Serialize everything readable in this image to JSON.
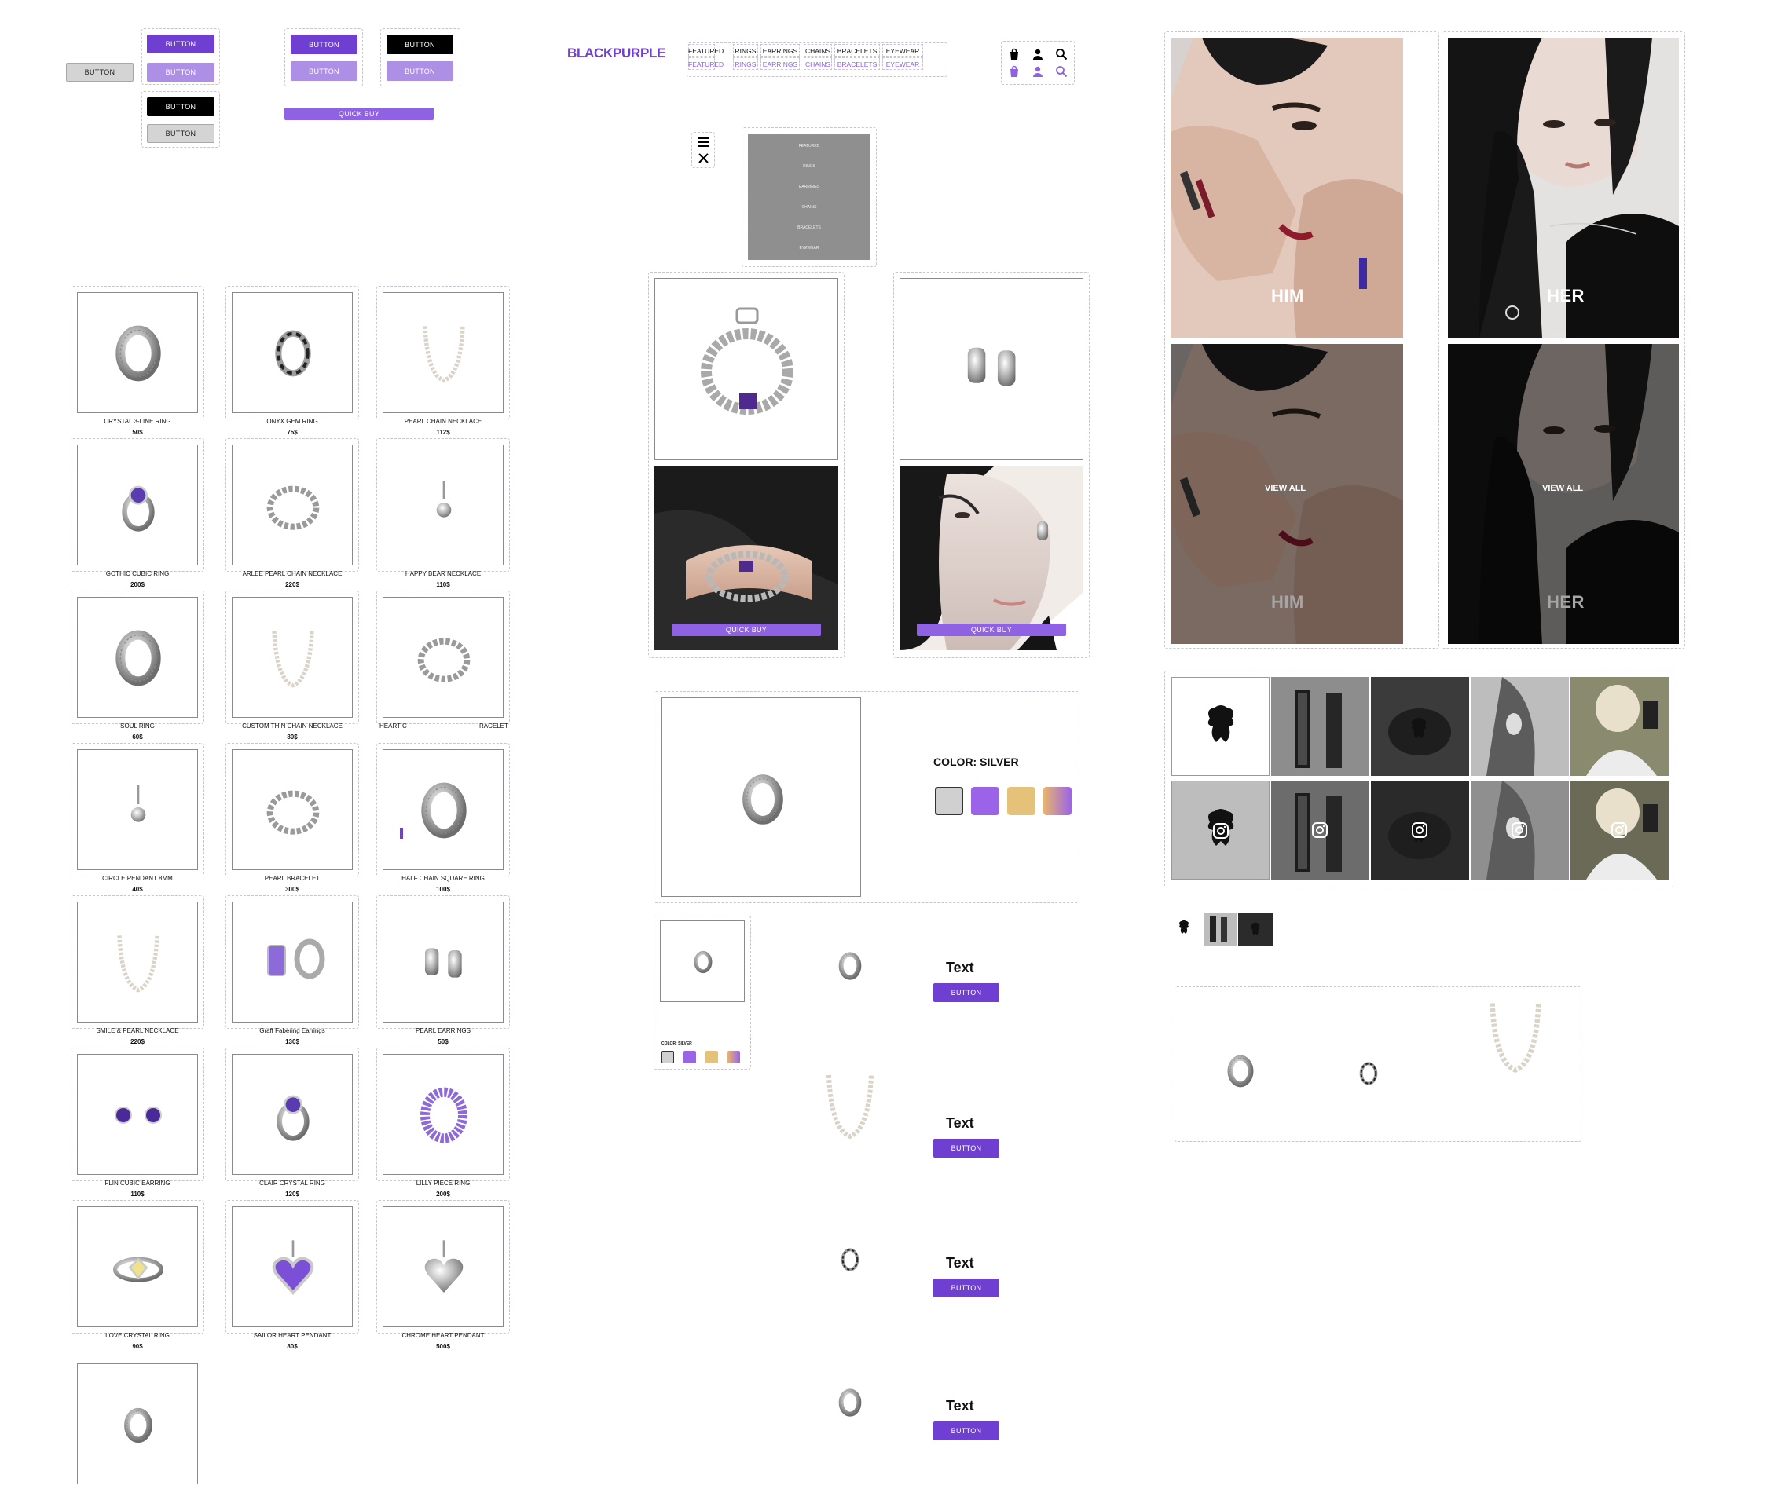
{
  "buttons": {
    "btn_label": "BUTTON",
    "quick_buy_label": "QUICK BUY"
  },
  "header": {
    "logo": "BLACKPURPLE",
    "nav": [
      "FEATURED",
      "RINGS",
      "EARRINGS",
      "CHAINS",
      "BRACELETS",
      "EYEWEAR"
    ]
  },
  "mobile_menu": {
    "items": [
      "FEATURED",
      "RINGS",
      "EARRINGS",
      "CHAINS",
      "BRACELETS",
      "EYEWEAR"
    ]
  },
  "products": [
    {
      "name": "CRYSTAL 3-LINE RING",
      "price": "50$"
    },
    {
      "name": "ONYX GEM RING",
      "price": "75$"
    },
    {
      "name": "PEARL CHAIN NECKLACE",
      "price": "112$"
    },
    {
      "name": "GOTHIC CUBIC RING",
      "price": "200$"
    },
    {
      "name": "ARLEE PEARL CHAIN NECKLACE",
      "price": "220$"
    },
    {
      "name": "HAPPY BEAR NECKLACE",
      "price": "110$"
    },
    {
      "name": "SOUL RING",
      "price": "60$"
    },
    {
      "name": "CUSTOM THIN CHAIN NECKLACE",
      "price": "80$"
    },
    {
      "name": "HEART C",
      "name2": "RACELET",
      "price": ""
    },
    {
      "name": "CIRCLE PENDANT 8MM",
      "price": "40$"
    },
    {
      "name": "PEARL BRACELET",
      "price": "300$"
    },
    {
      "name": "HALF CHAIN SQUARE RING",
      "price": "100$"
    },
    {
      "name": "SMILE & PEARL NECKLACE",
      "price": "220$"
    },
    {
      "name": "Graff Fabering Earrings",
      "price": "130$"
    },
    {
      "name": "PEARL EARRINGS",
      "price": "50$"
    },
    {
      "name": "FLIN CUBIC EARRING",
      "price": "110$"
    },
    {
      "name": "CLAIR CRYSTAL RING",
      "price": "120$"
    },
    {
      "name": "LILLY PIECE RING",
      "price": "200$"
    },
    {
      "name": "LOVE CRYSTAL RING",
      "price": "90$"
    },
    {
      "name": "SAILOR HEART PENDANT",
      "price": "80$"
    },
    {
      "name": "CHROME HEART PENDANT",
      "price": "500$"
    }
  ],
  "hero": {
    "him": "HIM",
    "her": "HER",
    "view_all": "VIEW ALL"
  },
  "detail": {
    "color_label": "COLOR: SILVER",
    "color_label_small": "COLOR: SILVER",
    "swatch_colors": [
      "#d0d0d0",
      "#9b63e8",
      "#e5c27a",
      "#c58ec6"
    ]
  },
  "list_rows": [
    {
      "text": "Text",
      "button": "BUTTON"
    },
    {
      "text": "Text",
      "button": "BUTTON"
    },
    {
      "text": "Text",
      "button": "BUTTON"
    },
    {
      "text": "Text",
      "button": "BUTTON"
    }
  ],
  "colors": {
    "purple": "#6f3fd1",
    "lavender": "#ad8fe6",
    "quick": "#8e62e3"
  }
}
